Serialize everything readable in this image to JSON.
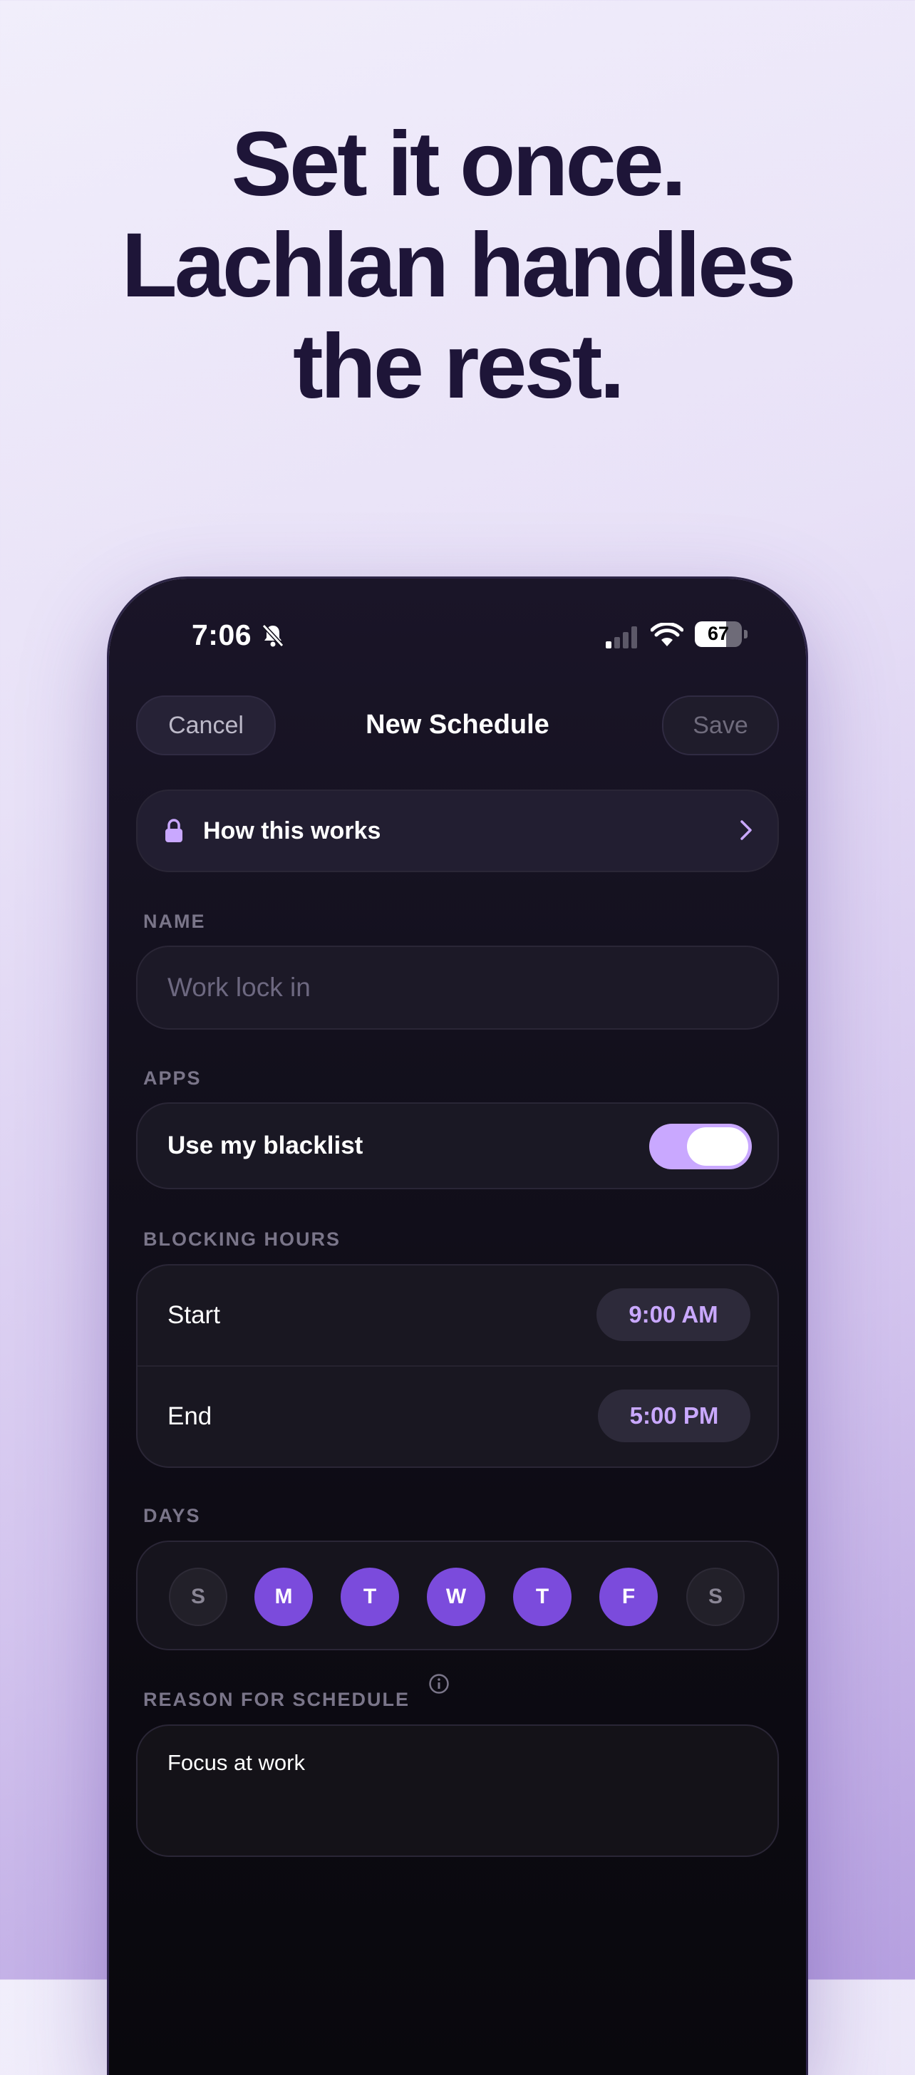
{
  "headline": [
    "Set it once.",
    "Lachlan handles",
    "the rest."
  ],
  "status_bar": {
    "time": "7:06",
    "battery": "67"
  },
  "navbar": {
    "cancel": "Cancel",
    "title": "New Schedule",
    "save": "Save"
  },
  "info_row": {
    "label": "How this works"
  },
  "name": {
    "section": "NAME",
    "placeholder": "Work lock in"
  },
  "apps": {
    "section": "APPS",
    "label": "Use my blacklist",
    "toggle_on": true
  },
  "blocking_hours": {
    "section": "BLOCKING HOURS",
    "start_label": "Start",
    "start_value": "9:00 AM",
    "end_label": "End",
    "end_value": "5:00 PM"
  },
  "days": {
    "section": "DAYS",
    "items": [
      {
        "label": "S",
        "selected": false
      },
      {
        "label": "M",
        "selected": true
      },
      {
        "label": "T",
        "selected": true
      },
      {
        "label": "W",
        "selected": true
      },
      {
        "label": "T",
        "selected": true
      },
      {
        "label": "F",
        "selected": true
      },
      {
        "label": "S",
        "selected": false
      }
    ]
  },
  "reason": {
    "section": "REASON FOR SCHEDULE",
    "value": "Focus at work"
  },
  "colors": {
    "accent": "#7b4bdc",
    "accent_light": "#c9a8ff",
    "headline": "#1e1538"
  }
}
